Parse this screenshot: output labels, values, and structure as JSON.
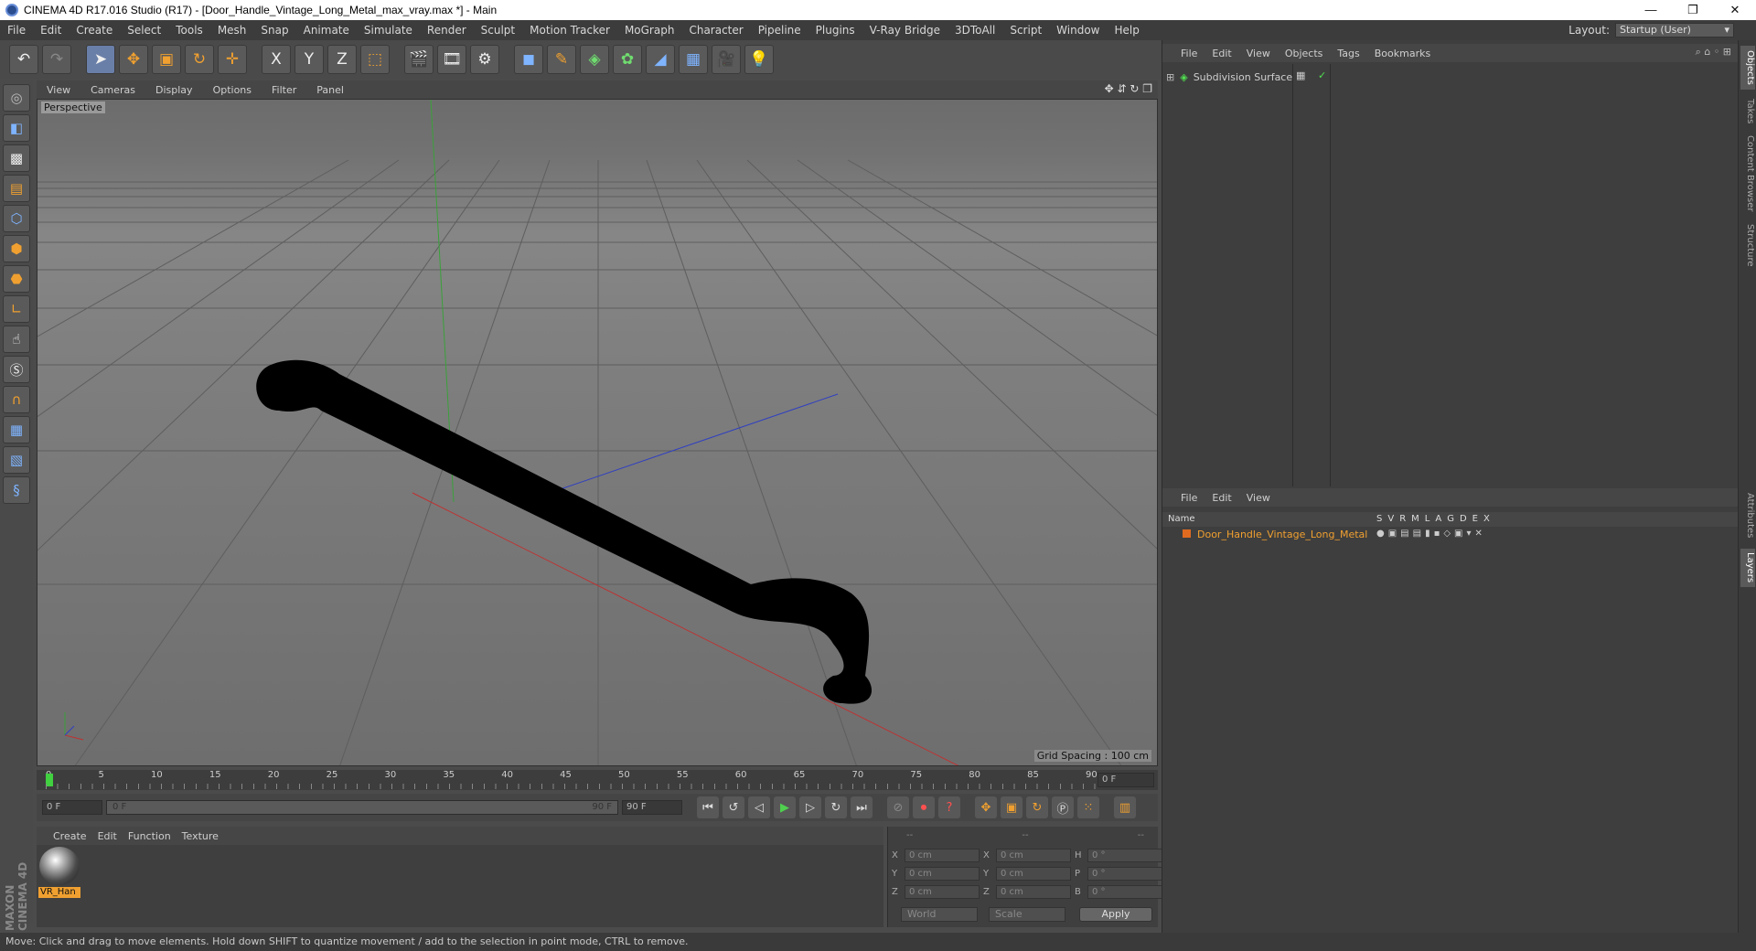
{
  "window": {
    "title": "CINEMA 4D R17.016 Studio (R17) - [Door_Handle_Vintage_Long_Metal_max_vray.max *] - Main",
    "minimize": "—",
    "restore": "❐",
    "close": "✕"
  },
  "menubar": {
    "items": [
      "File",
      "Edit",
      "Create",
      "Select",
      "Tools",
      "Mesh",
      "Snap",
      "Animate",
      "Simulate",
      "Render",
      "Sculpt",
      "Motion Tracker",
      "MoGraph",
      "Character",
      "Pipeline",
      "Plugins",
      "V-Ray Bridge",
      "3DToAll",
      "Script",
      "Window",
      "Help"
    ],
    "layout_label": "Layout:",
    "layout_value": "Startup (User)"
  },
  "toolbar": {
    "icons": [
      "undo-icon",
      "redo-icon",
      "select-arrow-icon",
      "move-icon",
      "scale-icon",
      "rotate-icon",
      "live-selection-icon",
      "x-axis-icon",
      "y-axis-icon",
      "z-axis-icon",
      "coordinate-system-icon",
      "render-view-icon",
      "render-picture-viewer-icon",
      "render-settings-icon",
      "cube-icon",
      "pen-icon",
      "subdivision-icon",
      "cloner-icon",
      "deformer-icon",
      "floor-icon",
      "camera-icon",
      "light-icon"
    ],
    "axis_x": "X",
    "axis_y": "Y",
    "axis_z": "Z"
  },
  "lefttools": {
    "icons": [
      "make-editable-icon",
      "model-mode-icon",
      "texture-mode-icon",
      "workplane-icon",
      "points-mode-icon",
      "edges-mode-icon",
      "polygons-mode-icon",
      "axis-mode-icon",
      "tweak-mode-icon",
      "snap-s-icon",
      "magnet-icon",
      "grid-lock-icon",
      "workplane-lock-icon",
      "python-icon"
    ]
  },
  "viewport": {
    "menu": [
      "View",
      "Cameras",
      "Display",
      "Options",
      "Filter",
      "Panel"
    ],
    "label": "Perspective",
    "grid_spacing": "Grid Spacing : 100 cm"
  },
  "timeline": {
    "ticks": [
      "0",
      "5",
      "10",
      "15",
      "20",
      "25",
      "30",
      "35",
      "40",
      "45",
      "50",
      "55",
      "60",
      "65",
      "70",
      "75",
      "80",
      "85",
      "90"
    ],
    "current_frame": "0 F",
    "end_frame_field": "0 F"
  },
  "playbar": {
    "start": "0 F",
    "range_start": "0 F",
    "range_end": "90 F",
    "end": "90 F"
  },
  "material": {
    "menu": [
      "Create",
      "Edit",
      "Function",
      "Texture"
    ],
    "name": "VR_Han"
  },
  "coords": {
    "header": [
      "--",
      "--",
      "--"
    ],
    "rows": [
      {
        "a": "X",
        "av": "0 cm",
        "b": "X",
        "bv": "0 cm",
        "c": "H",
        "cv": "0 °"
      },
      {
        "a": "Y",
        "av": "0 cm",
        "b": "Y",
        "bv": "0 cm",
        "c": "P",
        "cv": "0 °"
      },
      {
        "a": "Z",
        "av": "0 cm",
        "b": "Z",
        "bv": "0 cm",
        "c": "B",
        "cv": "0 °"
      }
    ],
    "space": "World",
    "mode": "Scale",
    "apply": "Apply"
  },
  "objects_panel": {
    "menu": [
      "File",
      "Edit",
      "View",
      "Objects",
      "Tags",
      "Bookmarks"
    ],
    "object_name": "Subdivision Surface"
  },
  "layers_panel": {
    "menu": [
      "File",
      "Edit",
      "View"
    ],
    "name_header": "Name",
    "columns": [
      "S",
      "V",
      "R",
      "M",
      "L",
      "A",
      "G",
      "D",
      "E",
      "X"
    ],
    "object_name": "Door_Handle_Vintage_Long_Metal"
  },
  "side_tabs": [
    "Objects",
    "Takes",
    "Content Browser",
    "Structure",
    "Attributes",
    "Layers"
  ],
  "status": "Move: Click and drag to move elements. Hold down SHIFT to quantize movement / add to the selection in point mode, CTRL to remove.",
  "brand": "MAXON CINEMA 4D"
}
